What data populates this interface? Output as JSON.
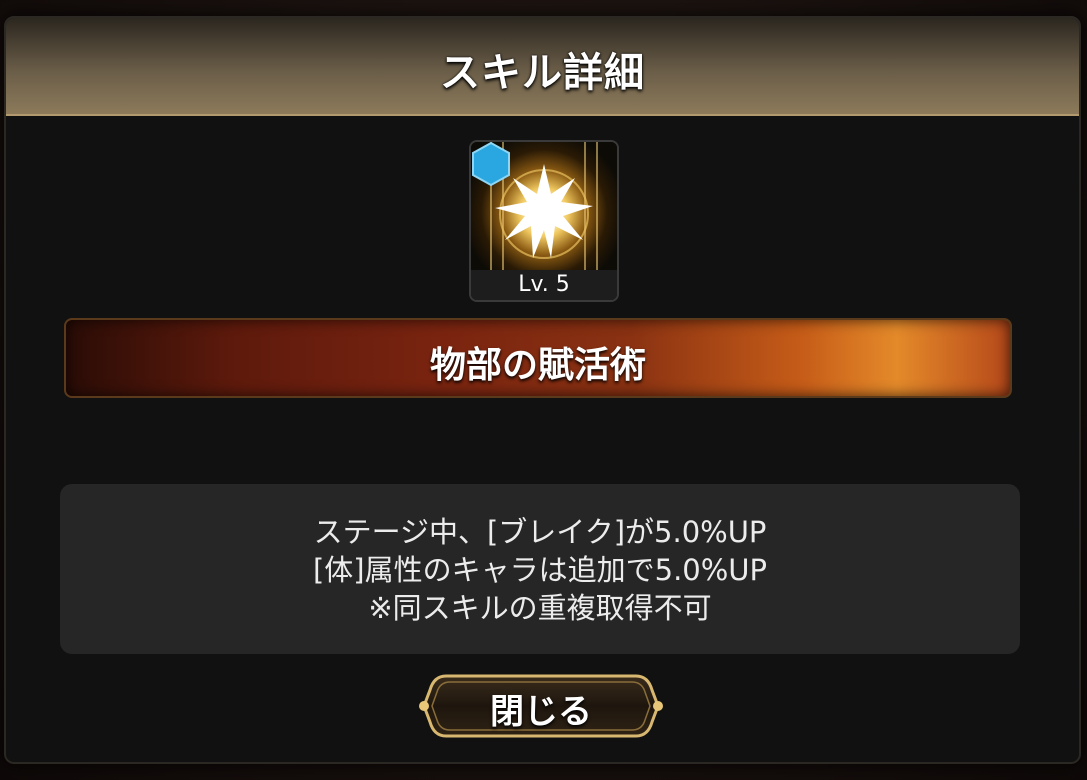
{
  "dialog": {
    "title": "スキル詳細"
  },
  "skill": {
    "level_label": "Lv. 5",
    "name": "物部の賦活術",
    "icon": "light-burst-icon",
    "badge_icon": "hexagon-badge-icon",
    "badge_color": "#2aa7e0",
    "description": [
      "ステージ中、[ブレイク]が5.0%UP",
      "[体]属性のキャラは追加で5.0%UP",
      "※同スキルの重複取得不可"
    ]
  },
  "buttons": {
    "close_label": "閉じる"
  }
}
